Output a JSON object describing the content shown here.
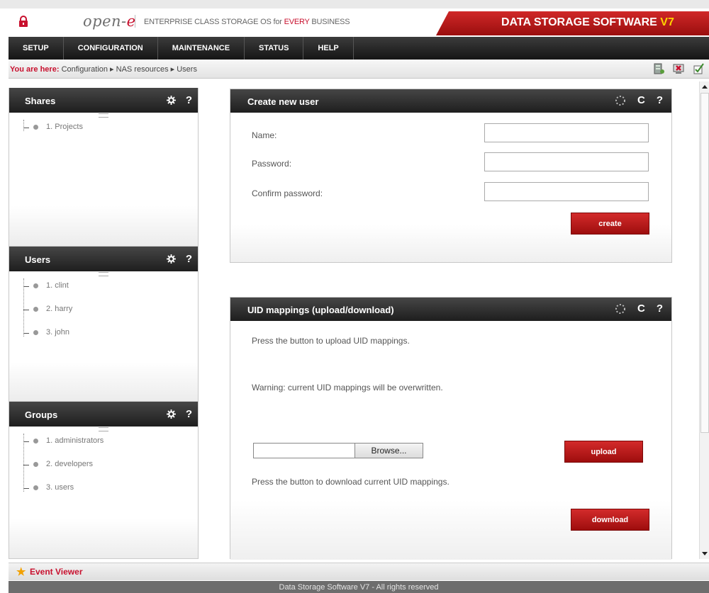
{
  "header": {
    "logo_text": "open-",
    "logo_e": "e",
    "tagline_pre": "ENTERPRISE CLASS STORAGE OS for ",
    "tagline_red": "EVERY",
    "tagline_post": " BUSINESS",
    "product": "DATA STORAGE SOFTWARE ",
    "product_version": "V7"
  },
  "nav": {
    "items": [
      "SETUP",
      "CONFIGURATION",
      "MAINTENANCE",
      "STATUS",
      "HELP"
    ]
  },
  "breadcrumb": {
    "label": "You are here:",
    "path": "Configuration ▸ NAS resources ▸ Users"
  },
  "left_panels": {
    "shares": {
      "title": "Shares",
      "items": [
        "1. Projects"
      ]
    },
    "users": {
      "title": "Users",
      "items": [
        "1. clint",
        "2. harry",
        "3. john"
      ]
    },
    "groups": {
      "title": "Groups",
      "items": [
        "1. administrators",
        "2. developers",
        "3. users"
      ]
    },
    "help_glyph": "?"
  },
  "create_user": {
    "title": "Create new user",
    "name_label": "Name:",
    "password_label": "Password:",
    "confirm_label": "Confirm password:",
    "name_value": "",
    "password_value": "",
    "confirm_value": "",
    "create_button": "create"
  },
  "uid_mappings": {
    "title": "UID mappings (upload/download)",
    "upload_text": "Press the button to upload UID mappings.",
    "warning_text": "Warning: current UID mappings will be overwritten.",
    "browse_button": "Browse...",
    "upload_button": "upload",
    "download_text": "Press the button to download current UID mappings.",
    "download_button": "download"
  },
  "panel_tools": {
    "refresh_glyph": "C",
    "help_glyph": "?"
  },
  "event_viewer": {
    "label": "Event Viewer"
  },
  "footer": {
    "text": "Data Storage Software V7 - All rights reserved"
  },
  "colors": {
    "accent": "#c8102e",
    "header_dark": "#1e1e1e",
    "star": "#f2a100"
  },
  "icons": [
    "lock-icon",
    "gear-icon",
    "help-icon",
    "spinner-icon",
    "refresh-icon",
    "server-icon",
    "logout-icon",
    "update-icon",
    "star-icon"
  ]
}
